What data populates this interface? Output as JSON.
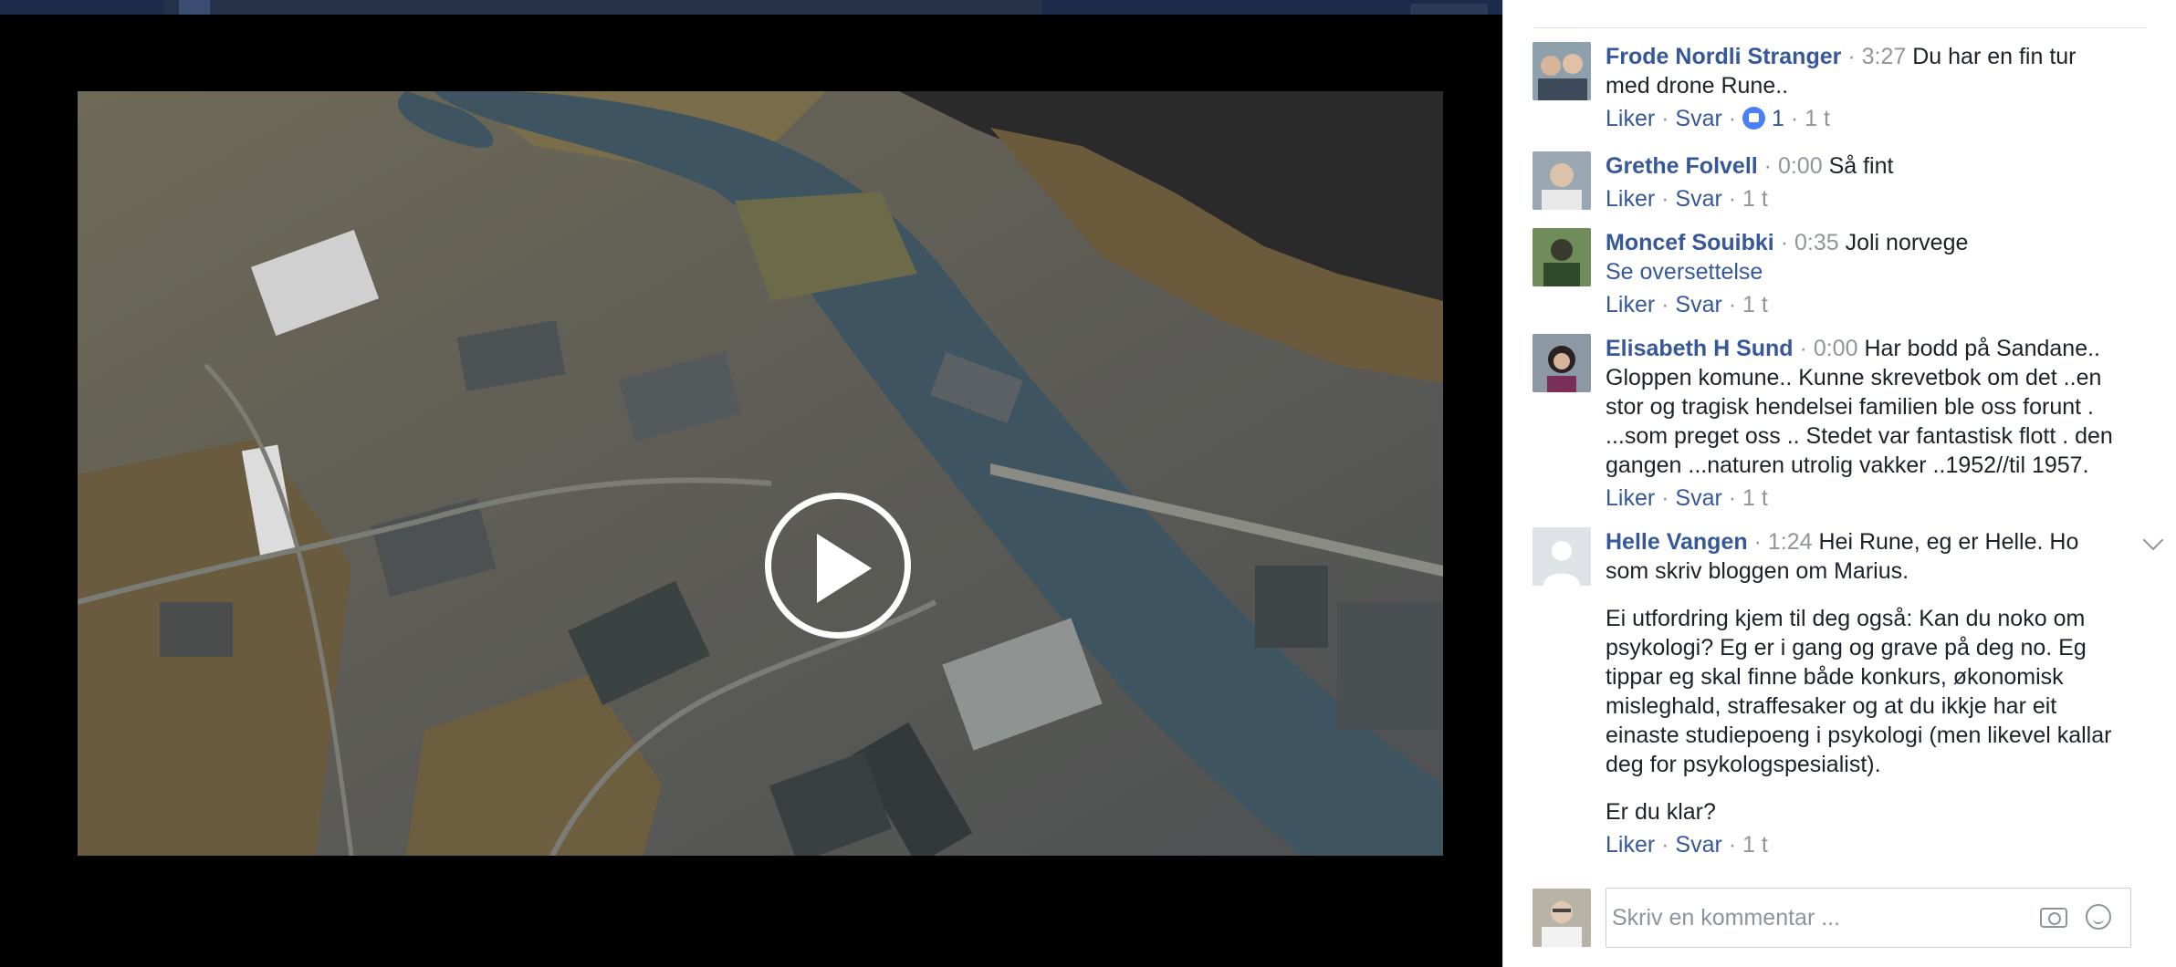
{
  "composer": {
    "placeholder": "Skriv en kommentar ..."
  },
  "comments": [
    {
      "author": "Frode Nordli Stranger",
      "time": "3:27",
      "text": "Du har en fin tur med drone Rune..",
      "like": "Liker",
      "reply": "Svar",
      "reactions": "1",
      "ago": "1 t"
    },
    {
      "author": "Grethe Folvell",
      "time": "0:00",
      "text": "Så fint",
      "like": "Liker",
      "reply": "Svar",
      "ago": "1 t"
    },
    {
      "author": "Moncef Souibki",
      "time": "0:35",
      "text": "Joli norvege",
      "translate": "Se oversettelse",
      "like": "Liker",
      "reply": "Svar",
      "ago": "1 t"
    },
    {
      "author": "Elisabeth H Sund",
      "time": "0:00",
      "text": "Har bodd på Sandane.. Gloppen komune.. Kunne skrevetbok om det ..en stor og tragisk hendelsei familien ble oss forunt . ...som preget oss .. Stedet var fantastisk flott . den gangen ...naturen utrolig vakker ..1952//til 1957.",
      "like": "Liker",
      "reply": "Svar",
      "ago": "1 t"
    },
    {
      "author": "Helle Vangen",
      "time": "1:24",
      "text": "Hei Rune, eg er Helle. Ho som skriv bloggen om Marius.",
      "para2": "Ei utfordring kjem til deg også: Kan du noko om psykologi? Eg er i gang og grave på deg no. Eg tippar eg skal finne både konkurs, økonomisk misleghald, straffesaker og at du ikkje har eit einaste studiepoeng i psykologi (men likevel kallar deg for psykologspesialist).",
      "para3": "Er du klar?",
      "like": "Liker",
      "reply": "Svar",
      "ago": "1 t"
    }
  ]
}
